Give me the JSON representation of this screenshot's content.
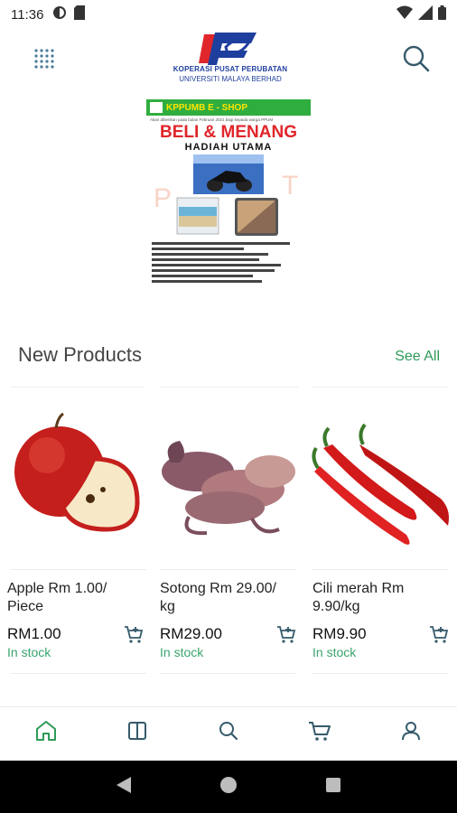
{
  "status_bar": {
    "time": "11:36",
    "left_icons": [
      "notification-circle-icon",
      "sim-card-icon"
    ],
    "right_icons": [
      "wifi-icon",
      "signal-icon",
      "battery-icon"
    ]
  },
  "header": {
    "menu_icon": "grid-menu-icon",
    "logo_line1": "KOPERASI PUSAT PERUBATAN",
    "logo_line2": "UNIVERSITI MALAYA BERHAD",
    "search_icon": "search-icon"
  },
  "banner": {
    "brand": "KPPUMB E - SHOP",
    "subtitle": "Akan diberikan pada bulan Februari 2021 bagi kepada warga PPUM",
    "headline": "BELI & MENANG",
    "prize": "HADIAH UTAMA"
  },
  "section": {
    "title": "New Products",
    "see_all": "See All"
  },
  "products": [
    {
      "name": "Apple Rm 1.00/ Piece",
      "price": "RM1.00",
      "stock": "In stock"
    },
    {
      "name": "Sotong Rm 29.00/ kg",
      "price": "RM29.00",
      "stock": "In stock"
    },
    {
      "name": "Cili merah Rm 9.90/kg",
      "price": "RM9.90",
      "stock": "In stock"
    }
  ],
  "bottom_nav": {
    "items": [
      "home-icon",
      "catalog-icon",
      "search-icon",
      "cart-icon",
      "account-icon"
    ],
    "active_color": "#2e9a57",
    "inactive_color": "#355a6b"
  },
  "colors": {
    "accent": "#2e9a57",
    "stock": "#3aa46c",
    "brand_blue": "#1f3f9e",
    "brand_red": "#e0262b"
  }
}
